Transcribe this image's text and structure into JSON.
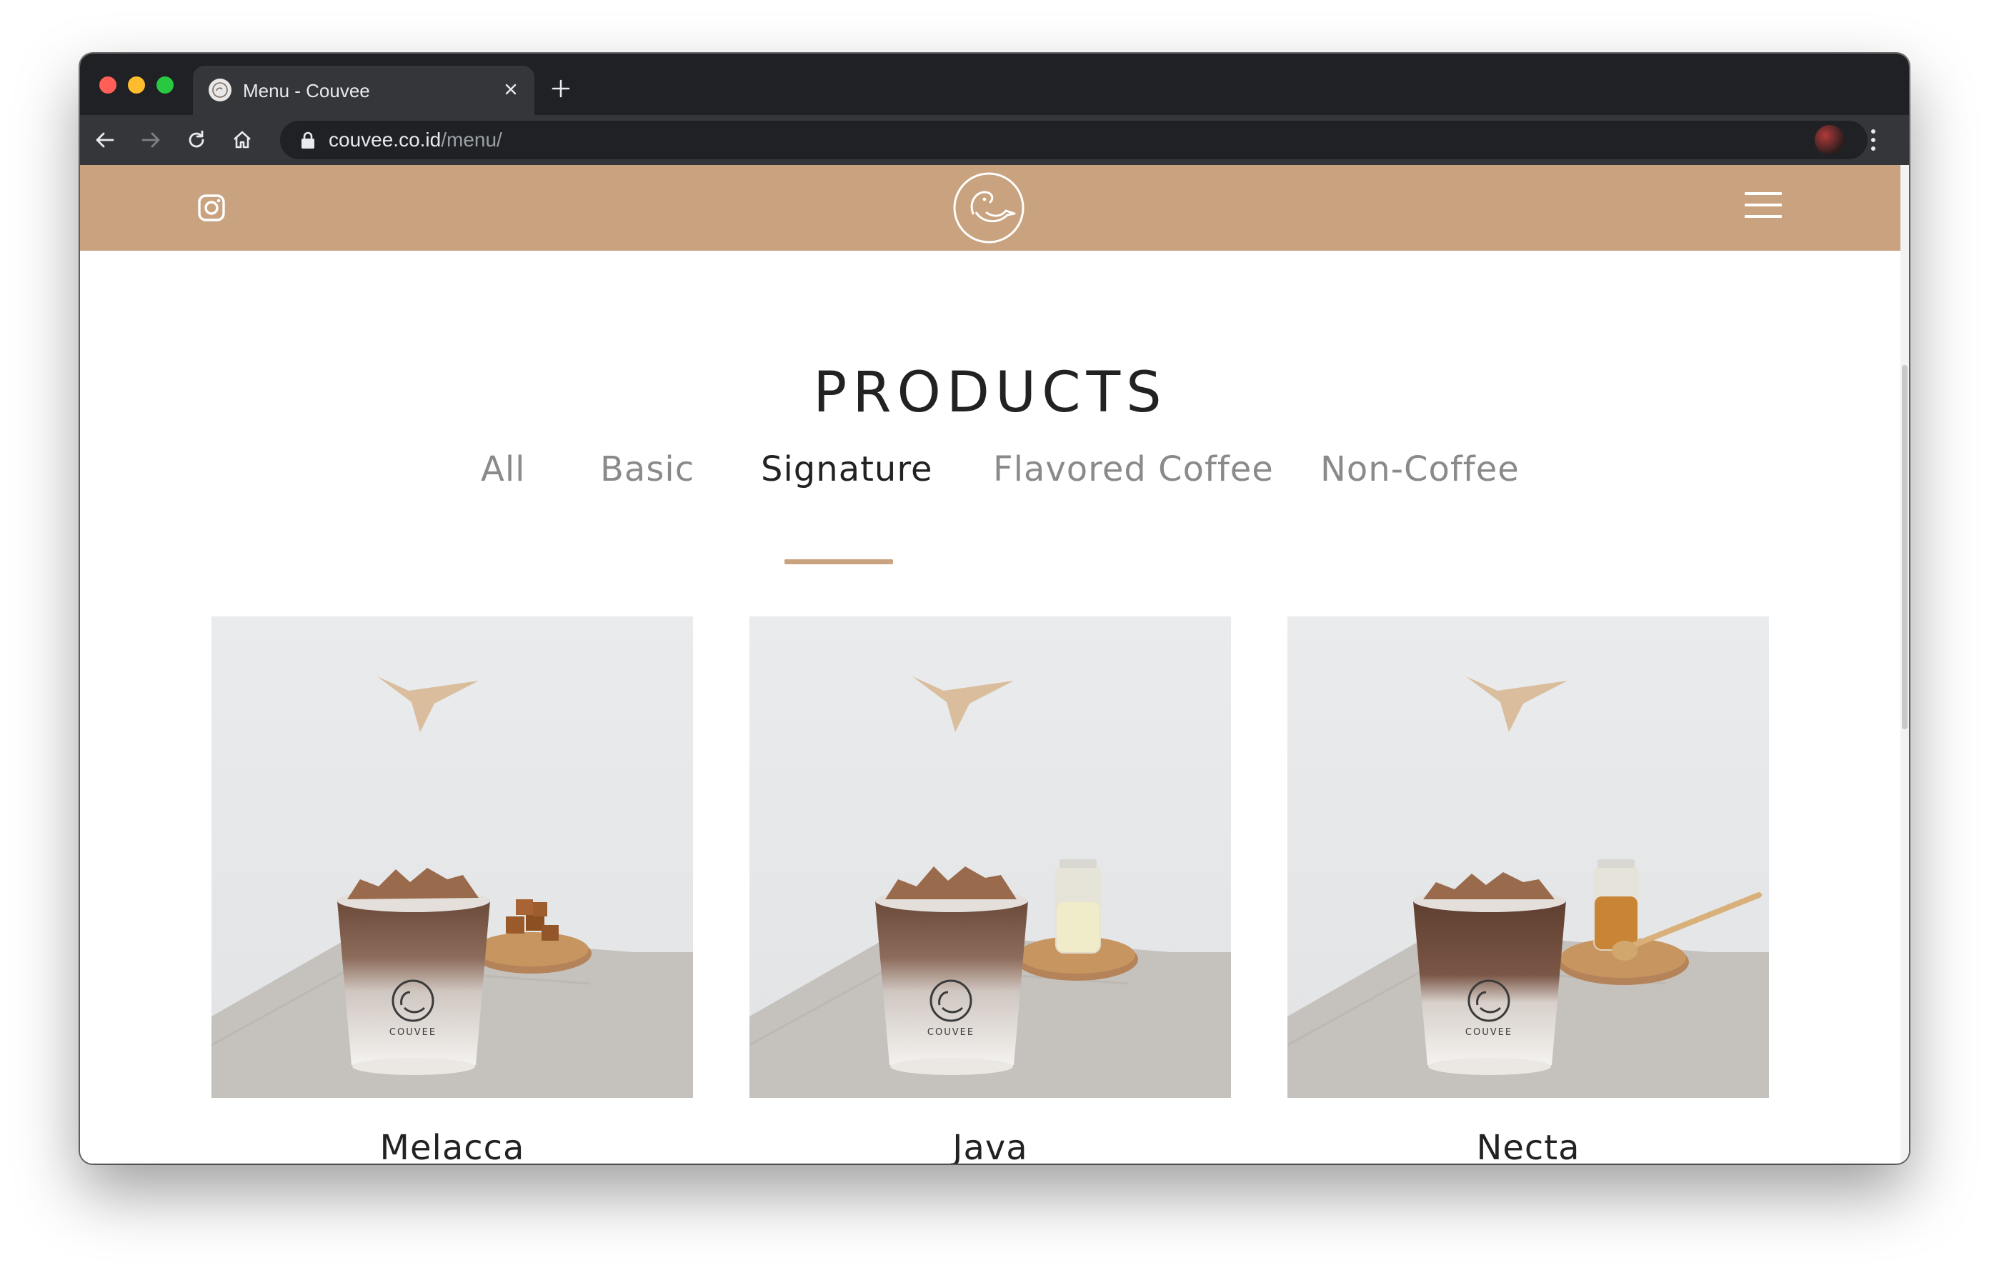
{
  "browser": {
    "tab_title": "Menu - Couvee",
    "url_host": "couvee.co.id",
    "url_path": "/menu/",
    "icons": [
      "back-icon",
      "forward-icon",
      "reload-icon",
      "home-icon",
      "lock-icon",
      "bookmark-star-icon",
      "new-tab-icon",
      "close-tab-icon",
      "profile-avatar",
      "menu-kebab-icon"
    ]
  },
  "site": {
    "brand_color": "#c9a27f",
    "header_icons": [
      "instagram-icon",
      "couvee-bird-logo",
      "hamburger-menu-icon"
    ]
  },
  "page": {
    "title": "PRODUCTS",
    "filters": [
      {
        "label": "All",
        "active": false
      },
      {
        "label": "Basic",
        "active": false
      },
      {
        "label": "Signature",
        "active": true
      },
      {
        "label": "Flavored Coffee",
        "active": false
      },
      {
        "label": "Non-Coffee",
        "active": false
      }
    ],
    "products": [
      {
        "name": "Melacca",
        "cup_label": "COUVEE",
        "side_item": "palm sugar cubes"
      },
      {
        "name": "Java",
        "cup_label": "COUVEE",
        "side_item": "glass jar of milk"
      },
      {
        "name": "Necta",
        "cup_label": "COUVEE",
        "side_item": "honey jar with dipper"
      }
    ]
  }
}
